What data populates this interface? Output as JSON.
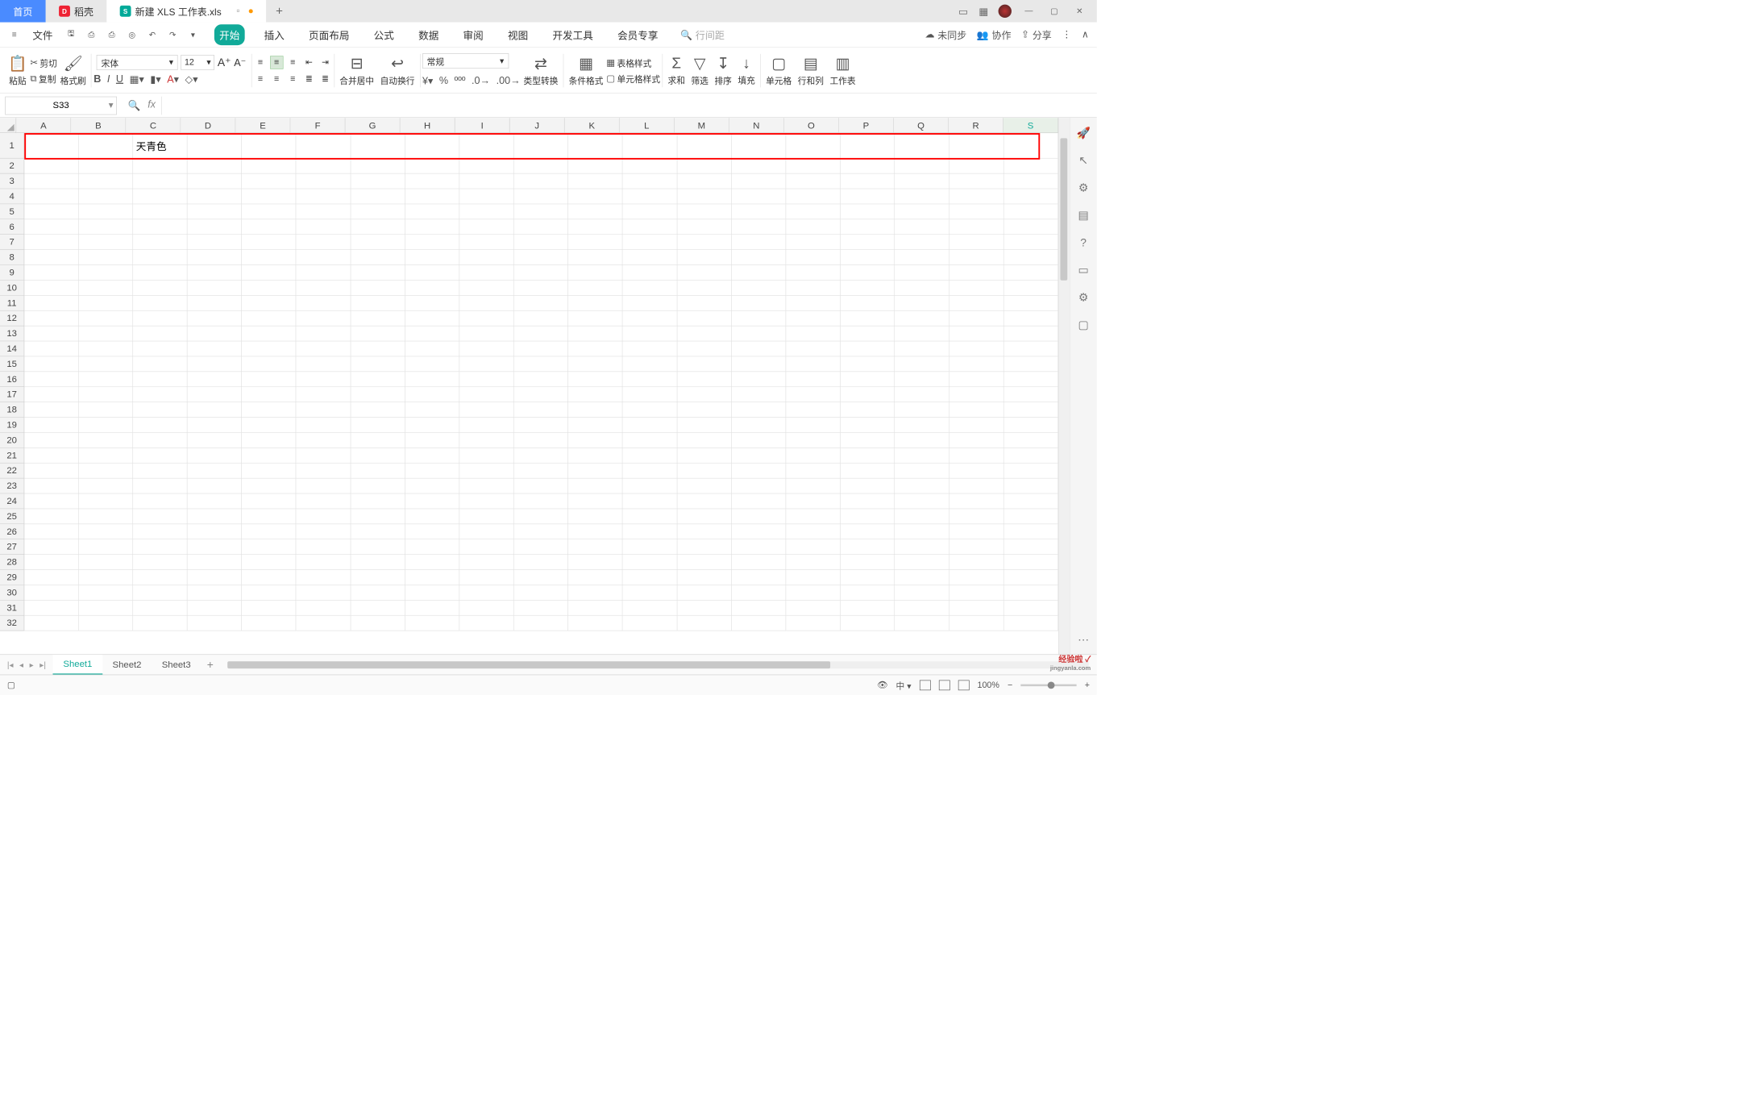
{
  "titlebar": {
    "home": "首页",
    "dk": "稻壳",
    "doc": "新建 XLS 工作表.xls"
  },
  "menubar": {
    "file": "文件",
    "tabs": [
      "开始",
      "插入",
      "页面布局",
      "公式",
      "数据",
      "审阅",
      "视图",
      "开发工具",
      "会员专享"
    ],
    "search_placeholder": "行间距",
    "sync": "未同步",
    "coop": "协作",
    "share": "分享"
  },
  "ribbon": {
    "paste": "粘贴",
    "cut": "剪切",
    "copy": "复制",
    "format_painter": "格式刷",
    "font_name": "宋体",
    "font_size": "12",
    "merge_center": "合并居中",
    "auto_wrap": "自动换行",
    "number_format": "常规",
    "type_convert": "类型转换",
    "cond_format": "条件格式",
    "table_style": "表格样式",
    "cell_style": "单元格样式",
    "sum": "求和",
    "filter": "筛选",
    "sort": "排序",
    "fill": "填充",
    "cell": "单元格",
    "rowcol": "行和列",
    "worksheet": "工作表"
  },
  "formula_bar": {
    "name": "S33"
  },
  "grid": {
    "columns": [
      "A",
      "B",
      "C",
      "D",
      "E",
      "F",
      "G",
      "H",
      "I",
      "J",
      "K",
      "L",
      "M",
      "N",
      "O",
      "P",
      "Q",
      "R",
      "S"
    ],
    "rows_count": 32,
    "selected_col": "S",
    "cells": {
      "C1": "天青色"
    }
  },
  "sheets": {
    "tabs": [
      "Sheet1",
      "Sheet2",
      "Sheet3"
    ],
    "active": 0
  },
  "statusbar": {
    "zoom": "100%"
  },
  "watermark": {
    "text": "经验啦",
    "sub": "jingyanla.com"
  }
}
